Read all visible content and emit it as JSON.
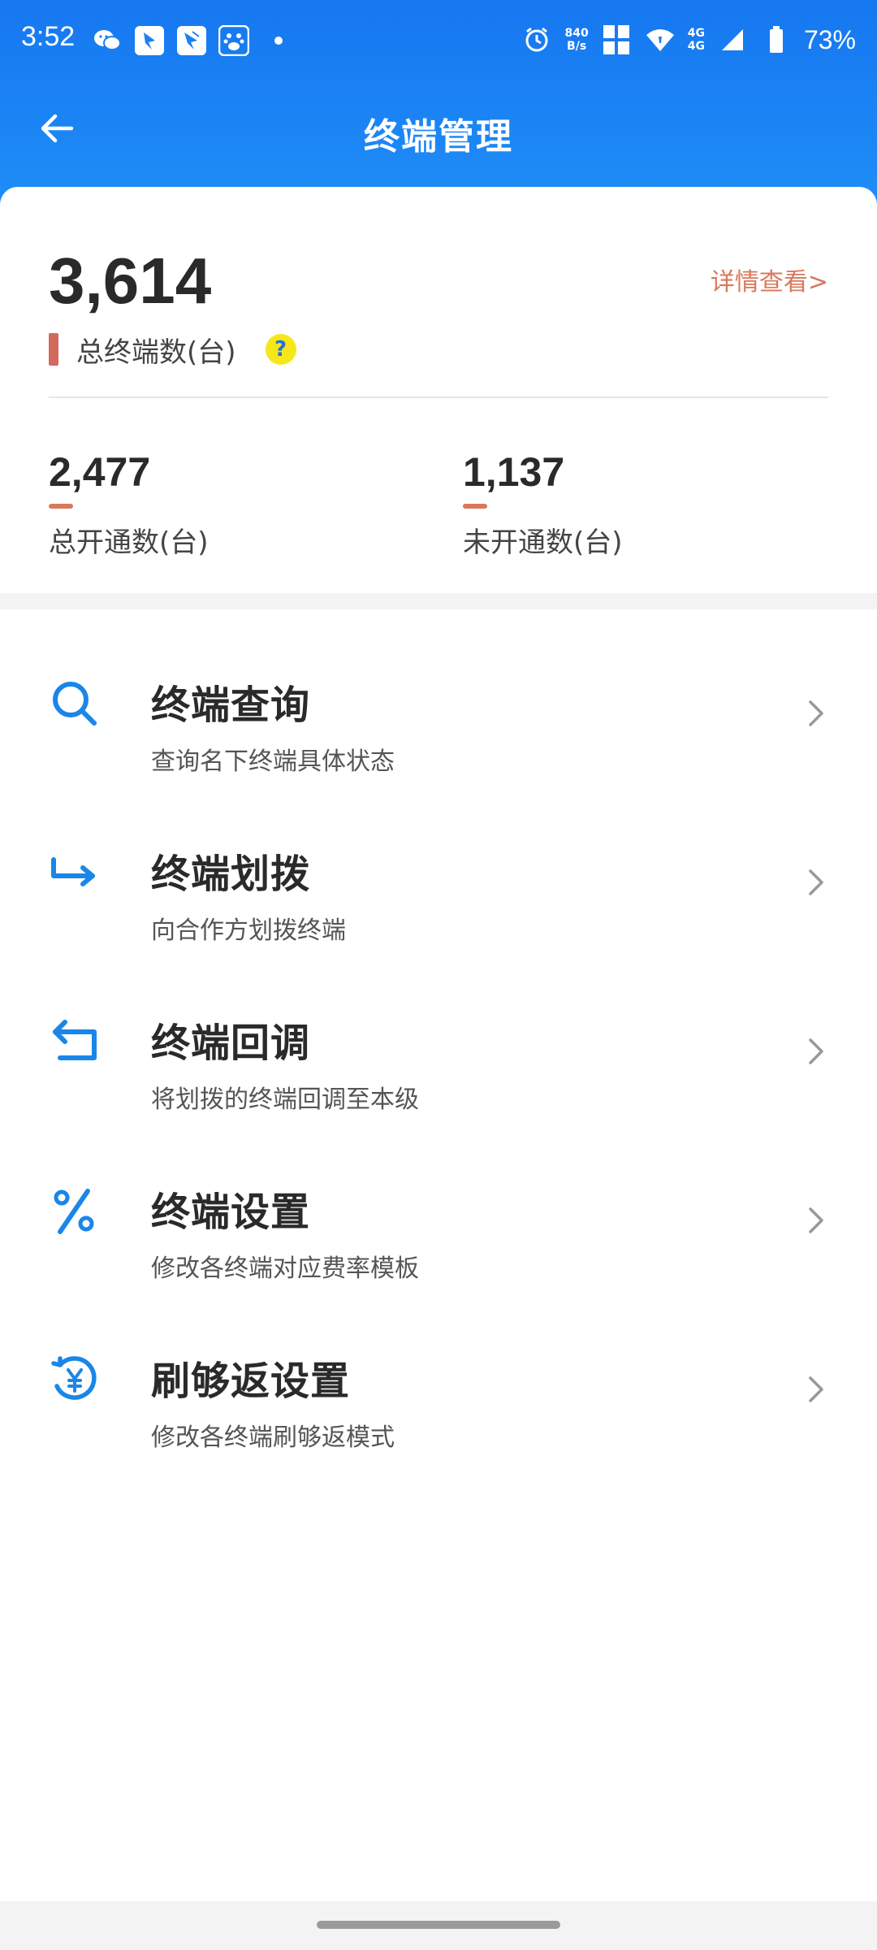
{
  "status_bar": {
    "time": "3:52",
    "net_speed_value": "840",
    "net_speed_unit": "B/s",
    "network_label_top": "4G",
    "network_label_bottom": "4G",
    "battery": "73%"
  },
  "header": {
    "title": "终端管理"
  },
  "summary": {
    "total_value": "3,614",
    "total_label": "总终端数(台)",
    "detail_link": "详情查看>",
    "help_symbol": "?",
    "activated_value": "2,477",
    "activated_label": "总开通数(台)",
    "inactive_value": "1,137",
    "inactive_label": "未开通数(台)"
  },
  "menu": {
    "items": [
      {
        "title": "终端查询",
        "desc": "查询名下终端具体状态",
        "icon": "search-icon"
      },
      {
        "title": "终端划拨",
        "desc": "向合作方划拨终端",
        "icon": "transfer-arrow-icon"
      },
      {
        "title": "终端回调",
        "desc": "将划拨的终端回调至本级",
        "icon": "return-arrow-icon"
      },
      {
        "title": "终端设置",
        "desc": "修改各终端对应费率模板",
        "icon": "percent-icon"
      },
      {
        "title": "刷够返设置",
        "desc": "修改各终端刷够返模式",
        "icon": "cashback-yen-icon"
      }
    ]
  },
  "colors": {
    "header_blue": "#1677f0",
    "accent_icon_blue": "#1a86e8",
    "accent_orange": "#d9785a",
    "help_yellow": "#f6e71a"
  }
}
